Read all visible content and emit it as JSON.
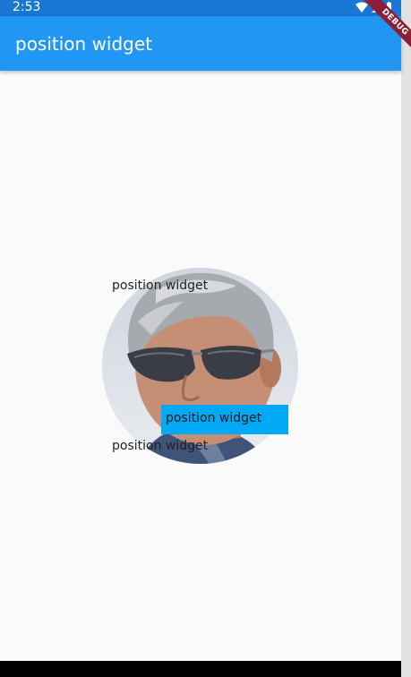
{
  "status_bar": {
    "time": "2:53",
    "background": "#1976d2"
  },
  "app_bar": {
    "title": "position widget",
    "background": "#2196f3"
  },
  "debug_banner": {
    "label": "DEBUG",
    "color": "#8b1f3a"
  },
  "stack": {
    "avatar_icon": "person-photo",
    "labels": {
      "top": "position widget",
      "highlighted": "position widget",
      "bottom": "position widget"
    },
    "highlight_color": "#03a9f4"
  }
}
